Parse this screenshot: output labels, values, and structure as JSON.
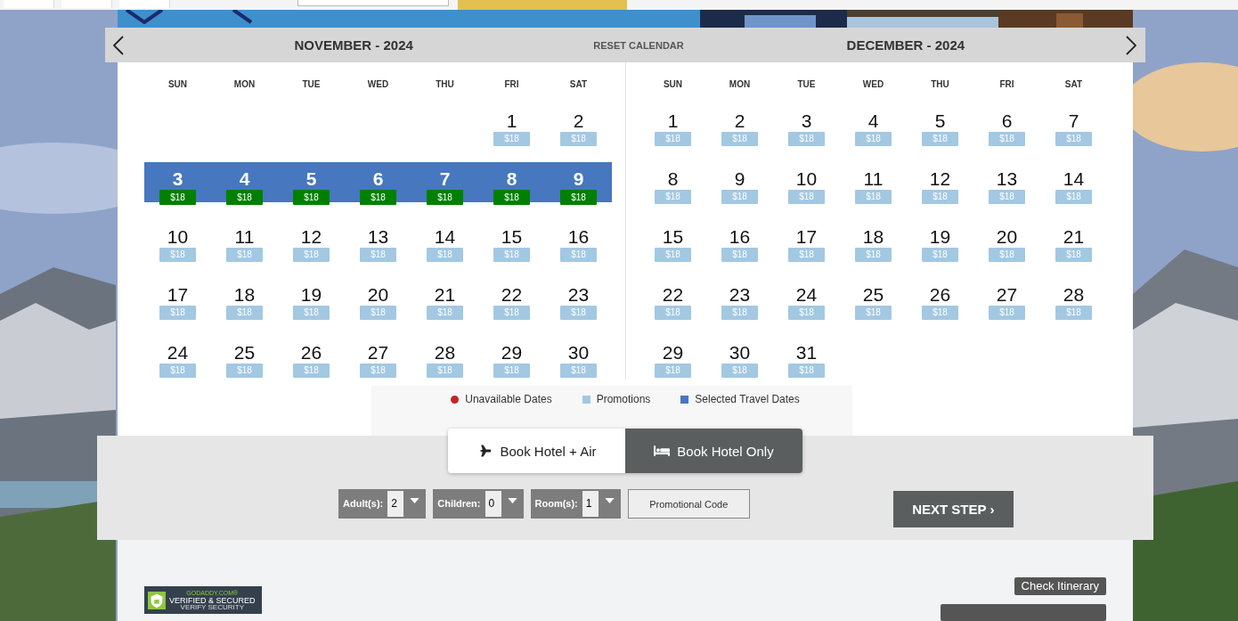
{
  "calendar": {
    "reset_label": "RESET CALENDAR",
    "months": [
      {
        "title": "NOVEMBER - 2024",
        "weekdays": [
          "SUN",
          "MON",
          "TUE",
          "WED",
          "THU",
          "FRI",
          "SAT"
        ],
        "weeks": [
          {
            "kind": "month_start",
            "days": [
              {
                "day": "1",
                "price": "$18",
                "selected": false
              },
              {
                "day": "2",
                "price": "$18",
                "selected": false
              }
            ]
          },
          {
            "kind": "full",
            "days": [
              {
                "day": "3",
                "price": "$18",
                "selected": true
              },
              {
                "day": "4",
                "price": "$18",
                "selected": true
              },
              {
                "day": "5",
                "price": "$18",
                "selected": true
              },
              {
                "day": "6",
                "price": "$18",
                "selected": true
              },
              {
                "day": "7",
                "price": "$18",
                "selected": true
              },
              {
                "day": "8",
                "price": "$18",
                "selected": true
              },
              {
                "day": "9",
                "price": "$18",
                "selected": true
              }
            ]
          },
          {
            "kind": "full",
            "days": [
              {
                "day": "10",
                "price": "$18",
                "selected": false
              },
              {
                "day": "11",
                "price": "$18",
                "selected": false
              },
              {
                "day": "12",
                "price": "$18",
                "selected": false
              },
              {
                "day": "13",
                "price": "$18",
                "selected": false
              },
              {
                "day": "14",
                "price": "$18",
                "selected": false
              },
              {
                "day": "15",
                "price": "$18",
                "selected": false
              },
              {
                "day": "16",
                "price": "$18",
                "selected": false
              }
            ]
          },
          {
            "kind": "full",
            "days": [
              {
                "day": "17",
                "price": "$18",
                "selected": false
              },
              {
                "day": "18",
                "price": "$18",
                "selected": false
              },
              {
                "day": "19",
                "price": "$18",
                "selected": false
              },
              {
                "day": "20",
                "price": "$18",
                "selected": false
              },
              {
                "day": "21",
                "price": "$18",
                "selected": false
              },
              {
                "day": "22",
                "price": "$18",
                "selected": false
              },
              {
                "day": "23",
                "price": "$18",
                "selected": false
              }
            ]
          },
          {
            "kind": "full",
            "days": [
              {
                "day": "24",
                "price": "$18",
                "selected": false
              },
              {
                "day": "25",
                "price": "$18",
                "selected": false
              },
              {
                "day": "26",
                "price": "$18",
                "selected": false
              },
              {
                "day": "27",
                "price": "$18",
                "selected": false
              },
              {
                "day": "28",
                "price": "$18",
                "selected": false
              },
              {
                "day": "29",
                "price": "$18",
                "selected": false
              },
              {
                "day": "30",
                "price": "$18",
                "selected": false
              }
            ]
          }
        ]
      },
      {
        "title": "DECEMBER - 2024",
        "weekdays": [
          "SUN",
          "MON",
          "TUE",
          "WED",
          "THU",
          "FRI",
          "SAT"
        ],
        "weeks": [
          {
            "kind": "full",
            "days": [
              {
                "day": "1",
                "price": "$18",
                "selected": false
              },
              {
                "day": "2",
                "price": "$18",
                "selected": false
              },
              {
                "day": "3",
                "price": "$18",
                "selected": false
              },
              {
                "day": "4",
                "price": "$18",
                "selected": false
              },
              {
                "day": "5",
                "price": "$18",
                "selected": false
              },
              {
                "day": "6",
                "price": "$18",
                "selected": false
              },
              {
                "day": "7",
                "price": "$18",
                "selected": false
              }
            ]
          },
          {
            "kind": "full",
            "days": [
              {
                "day": "8",
                "price": "$18",
                "selected": false
              },
              {
                "day": "9",
                "price": "$18",
                "selected": false
              },
              {
                "day": "10",
                "price": "$18",
                "selected": false
              },
              {
                "day": "11",
                "price": "$18",
                "selected": false
              },
              {
                "day": "12",
                "price": "$18",
                "selected": false
              },
              {
                "day": "13",
                "price": "$18",
                "selected": false
              },
              {
                "day": "14",
                "price": "$18",
                "selected": false
              }
            ]
          },
          {
            "kind": "full",
            "days": [
              {
                "day": "15",
                "price": "$18",
                "selected": false
              },
              {
                "day": "16",
                "price": "$18",
                "selected": false
              },
              {
                "day": "17",
                "price": "$18",
                "selected": false
              },
              {
                "day": "18",
                "price": "$18",
                "selected": false
              },
              {
                "day": "19",
                "price": "$18",
                "selected": false
              },
              {
                "day": "20",
                "price": "$18",
                "selected": false
              },
              {
                "day": "21",
                "price": "$18",
                "selected": false
              }
            ]
          },
          {
            "kind": "full",
            "days": [
              {
                "day": "22",
                "price": "$18",
                "selected": false
              },
              {
                "day": "23",
                "price": "$18",
                "selected": false
              },
              {
                "day": "24",
                "price": "$18",
                "selected": false
              },
              {
                "day": "25",
                "price": "$18",
                "selected": false
              },
              {
                "day": "26",
                "price": "$18",
                "selected": false
              },
              {
                "day": "27",
                "price": "$18",
                "selected": false
              },
              {
                "day": "28",
                "price": "$18",
                "selected": false
              }
            ]
          },
          {
            "kind": "month_end",
            "days": [
              {
                "day": "29",
                "price": "$18",
                "selected": false
              },
              {
                "day": "30",
                "price": "$18",
                "selected": false
              },
              {
                "day": "31",
                "price": "$18",
                "selected": false
              }
            ]
          }
        ]
      }
    ]
  },
  "legend": [
    {
      "label": "Unavailable Dates",
      "kind": "dot",
      "color": "#c0272d"
    },
    {
      "label": "Promotions",
      "kind": "square",
      "color": "#a3c8e2"
    },
    {
      "label": "Selected Travel Dates",
      "kind": "square",
      "color": "#4677bf"
    }
  ],
  "booking": {
    "modes": [
      {
        "label": "Book Hotel + Air",
        "kind": "air",
        "selected": false
      },
      {
        "label": "Book Hotel Only",
        "kind": "hotel",
        "selected": true
      }
    ],
    "selectors": [
      {
        "label": "Adult(s):",
        "value": "2"
      },
      {
        "label": "Children:",
        "value": "0"
      },
      {
        "label": "Room(s):",
        "value": "1"
      }
    ],
    "promo_button": "Promotional Code",
    "next_button": "NEXT STEP ›"
  },
  "footer": {
    "seal": [
      "GODADDY.COM®",
      "VERIFIED & SECURED",
      "VERIFY SECURITY"
    ],
    "buttons": [
      "Check Itinerary"
    ]
  }
}
